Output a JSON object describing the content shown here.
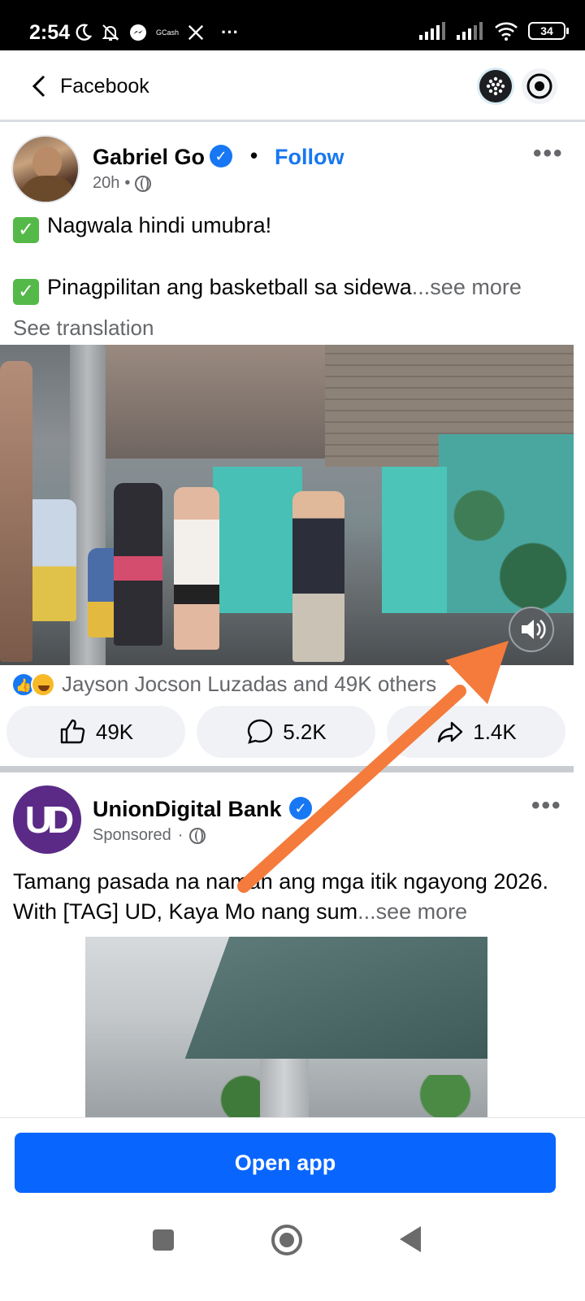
{
  "status_bar": {
    "time": "2:54",
    "battery": "34",
    "left_icons": [
      "moon-icon",
      "bell-off-icon",
      "messenger-icon",
      "gcash-icon",
      "x-icon",
      "more-icon"
    ],
    "gcash_label": "GCash",
    "more_label": "···"
  },
  "header": {
    "title": "Facebook"
  },
  "post1": {
    "author": "Gabriel Go",
    "dot": "•",
    "follow_label": "Follow",
    "time": "20h",
    "meta_dot": "•",
    "line1": "Nagwala hindi umubra!",
    "line2": "Pinagpilitan ang basketball sa sidewa",
    "see_more": "...see more",
    "see_translation": "See translation",
    "reactions_text": "Jayson Jocson Luzadas and 49K others",
    "likes": "49K",
    "comments": "5.2K",
    "shares": "1.4K",
    "more_label": "•••"
  },
  "post2": {
    "author": "UnionDigital Bank",
    "sponsored": "Sponsored",
    "meta_dot": "·",
    "text": "Tamang pasada na naman ang mga itik ngayong 2026. With [TAG] UD, Kaya Mo nang sum",
    "see_more": "...see more",
    "more_label": "•••",
    "avatar_text": "UD"
  },
  "footer": {
    "open_app_label": "Open app"
  },
  "colors": {
    "accent": "#1877f2",
    "open_app_bg": "#0866ff",
    "annotation_arrow": "#f47b3c"
  }
}
